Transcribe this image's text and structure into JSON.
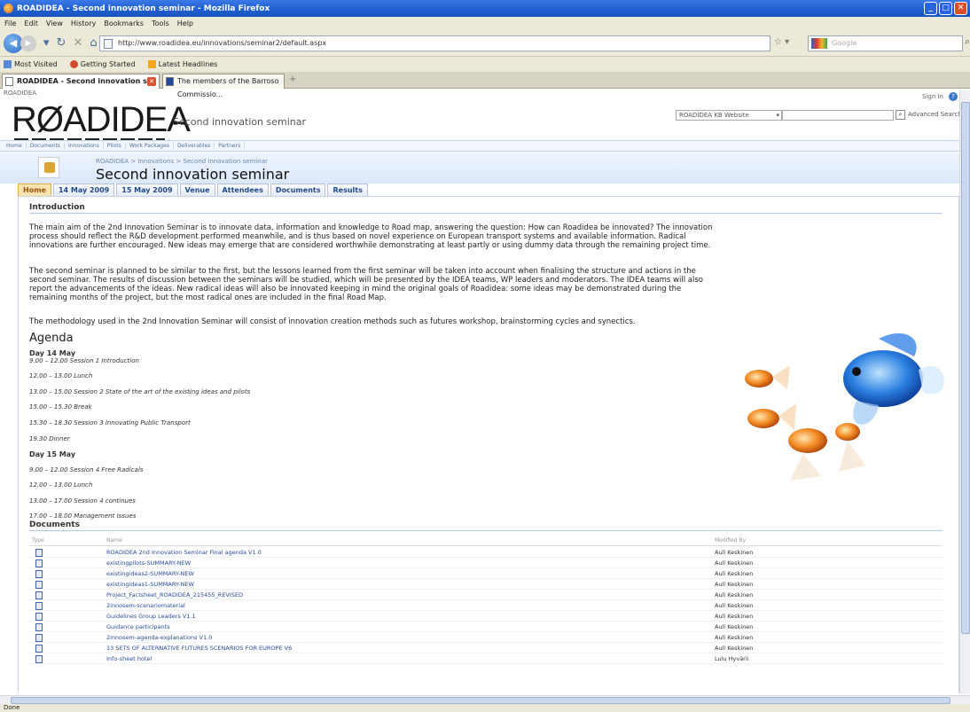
{
  "window": {
    "title": "ROADIDEA - Second innovation seminar - Mozilla Firefox"
  },
  "menu": [
    "File",
    "Edit",
    "View",
    "History",
    "Bookmarks",
    "Tools",
    "Help"
  ],
  "address": {
    "url": "http://www.roadidea.eu/innovations/seminar2/default.aspx",
    "search_placeholder": "Google"
  },
  "bookmarks": [
    "Most Visited",
    "Getting Started",
    "Latest Headlines"
  ],
  "browser_tabs": [
    {
      "label": "ROADIDEA - Second innovation s..."
    },
    {
      "label": "The members of the Barroso Commissio..."
    }
  ],
  "site": {
    "crumb_top": "ROADIDEA",
    "sign_in": "Sign In",
    "logo": "RØADIDEA",
    "subtitle": "Second innovation seminar",
    "search_scope": "ROADIDEA KB Website",
    "advanced": "Advanced Search",
    "nav": [
      "Home",
      "Documents",
      "Innovations",
      "Pilots",
      "Work Packages",
      "Deliverables",
      "Partners"
    ],
    "breadcrumb": "ROADIDEA > Innovations > Second innovation seminar",
    "page_title": "Second innovation seminar",
    "tabs": [
      "Home",
      "14 May 2009",
      "15 May 2009",
      "Venue",
      "Attendees",
      "Documents",
      "Results"
    ],
    "intro_heading": "Introduction",
    "paragraphs": [
      "The main aim of the 2nd Innovation Seminar is to innovate data, information and knowledge to Road map, answering the question: How can Roadidea be innovated? The innovation process should reflect the R&D development performed meanwhile, and is thus based on novel experience on European transport systems and available information. Radical innovations are further encouraged. New ideas may emerge that are considered worthwhile demonstrating at least partly or using dummy data through the remaining project time.",
      "The second seminar is planned to be similar to the first, but the lessons learned from the first seminar will be taken into account when finalising the structure and actions in the second seminar. The results of discussion between the seminars will be studied, which will be presented by the IDEA teams, WP leaders and moderators. The IDEA teams will also report the advancements of the ideas. New radical ideas will also be innovated keeping in mind the original goals of Roadidea: some ideas may be demonstrated during the remaining months of the project, but the most radical ones are included in the final Road Map.",
      "The methodology used in the 2nd Innovation Seminar will consist of innovation creation methods such as futures workshop, brainstorming cycles and synectics."
    ],
    "agenda_heading": "Agenda",
    "agenda": [
      {
        "t": "Day 14 May",
        "b": true
      },
      {
        "t": "9.00 – 12.00 Session 1  Introduction"
      },
      {
        "t": "12.00 – 13.00 Lunch"
      },
      {
        "t": "13.00 – 15.00 Session 2  State of the art of the existing ideas and pilots"
      },
      {
        "t": "15.00 – 15.30 Break"
      },
      {
        "t": "15.30 – 18.30 Session 3  Innovating Public Transport"
      },
      {
        "t": "19.30  Dinner"
      },
      {
        "t": "Day 15 May",
        "b": true
      },
      {
        "t": "9.00 – 12.00 Session 4  Free Radicals"
      },
      {
        "t": "12.00 – 13.00 Lunch"
      },
      {
        "t": "13.00 – 17.00 Session 4 continues"
      },
      {
        "t": "17.00 – 18.00 Management Issues"
      }
    ],
    "docs_heading": "Documents",
    "doc_cols": {
      "type": "Type",
      "name": "Name",
      "modified": "Modified By"
    },
    "documents": [
      {
        "name": "ROADIDEA 2nd Innovation Seminar Final agenda V1.0",
        "by": "Auli Keskinen"
      },
      {
        "name": "existingpilots-SUMMARY-NEW",
        "by": "Auli Keskinen"
      },
      {
        "name": "existingideas2-SUMMARY-NEW",
        "by": "Auli Keskinen"
      },
      {
        "name": "existingideas1-SUMMARY-NEW",
        "by": "Auli Keskinen"
      },
      {
        "name": "Project_Factsheet_ROADIDEA_215455_REVISED",
        "by": "Auli Keskinen"
      },
      {
        "name": "2innosem-scenariomaterial",
        "by": "Auli Keskinen"
      },
      {
        "name": "Guidelines Group Leaders V1.1",
        "by": "Auli Keskinen"
      },
      {
        "name": "Guidance participants",
        "by": "Auli Keskinen"
      },
      {
        "name": "2innosem-agenda-explanations V1.0",
        "by": "Auli Keskinen"
      },
      {
        "name": "13 SETS OF ALTERNATIVE FUTURES SCENARIOS FOR EUROPE V6",
        "by": "Auli Keskinen"
      },
      {
        "name": "Info-sheet hotel",
        "by": "Lulu Hyvärii"
      }
    ]
  },
  "status": "Done"
}
